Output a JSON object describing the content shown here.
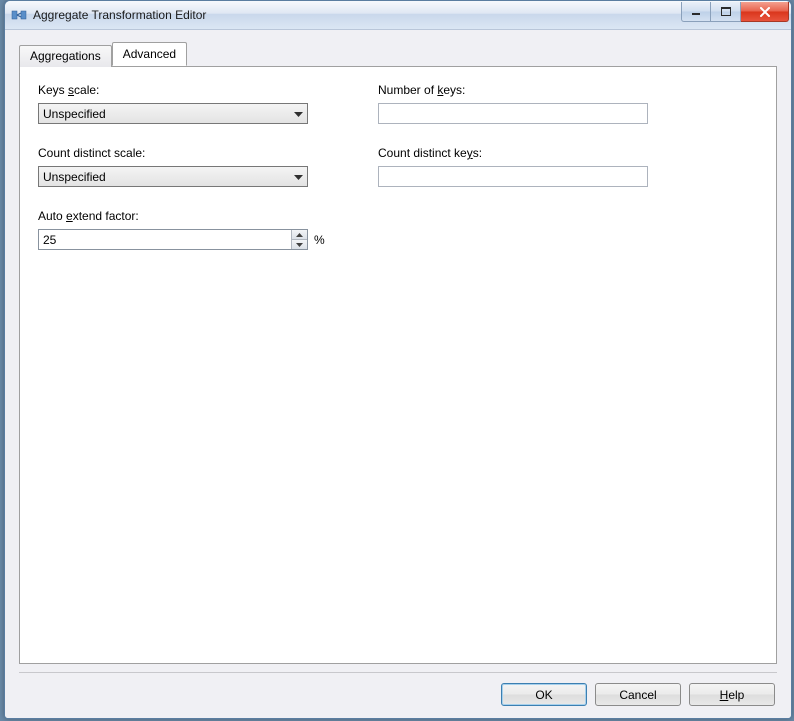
{
  "window": {
    "title": "Aggregate Transformation Editor"
  },
  "tabs": {
    "aggregations": "Aggregations",
    "advanced": "Advanced"
  },
  "labels": {
    "keys_scale_pre": "Keys ",
    "keys_scale_ul": "s",
    "keys_scale_post": "cale:",
    "number_keys_pre": "Number of ",
    "number_keys_ul": "k",
    "number_keys_post": "eys:",
    "count_distinct_scale": "Count distinct scale:",
    "count_distinct_keys_pre": "Count distinct ke",
    "count_distinct_keys_ul": "y",
    "count_distinct_keys_post": "s:",
    "auto_extend_pre": "Auto ",
    "auto_extend_ul": "e",
    "auto_extend_post": "xtend factor:",
    "percent": "%"
  },
  "values": {
    "keys_scale": "Unspecified",
    "count_distinct_scale": "Unspecified",
    "number_of_keys": "",
    "count_distinct_keys": "",
    "auto_extend_factor": "25"
  },
  "buttons": {
    "ok": "OK",
    "cancel": "Cancel",
    "help_ul": "H",
    "help_post": "elp"
  }
}
